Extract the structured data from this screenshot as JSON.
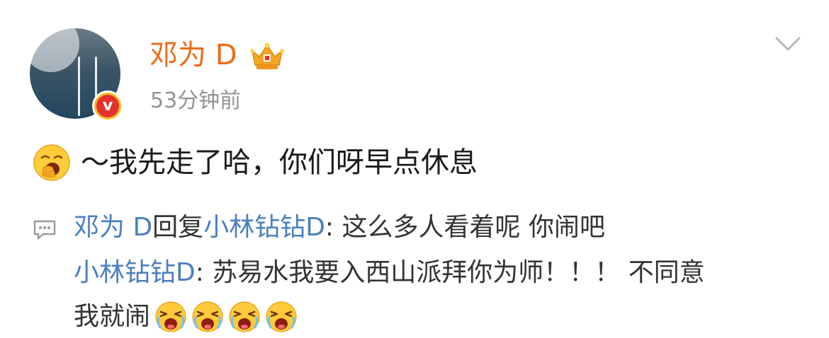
{
  "post": {
    "author": "邓为 D",
    "time": "53分钟前",
    "text": "～我先走了哈，你们呀早点休息",
    "icons": {
      "avatar": "user-avatar",
      "verified": "verified-badge-icon",
      "crown": "crown-badge-icon",
      "menu": "chevron-down-icon",
      "emoji": "yawn-emoji-icon"
    }
  },
  "comments": {
    "line1": {
      "author": "邓为 D",
      "action": "回复",
      "reply_to": "小林钻钻D",
      "text": ": 这么多人看着呢 你闹吧"
    },
    "line2": {
      "author": "小林钻钻D",
      "text": ": 苏易水我要入西山派拜你为师！！！ 不同意"
    },
    "line3": {
      "text": "我就闹"
    },
    "emoji_icon": "crying-emoji-icon",
    "comment_icon": "comment-bubble-icon"
  },
  "colors": {
    "username": "#ef6c1a",
    "link": "#4b7fbe",
    "time": "#939393",
    "text": "#1a1a1a"
  }
}
